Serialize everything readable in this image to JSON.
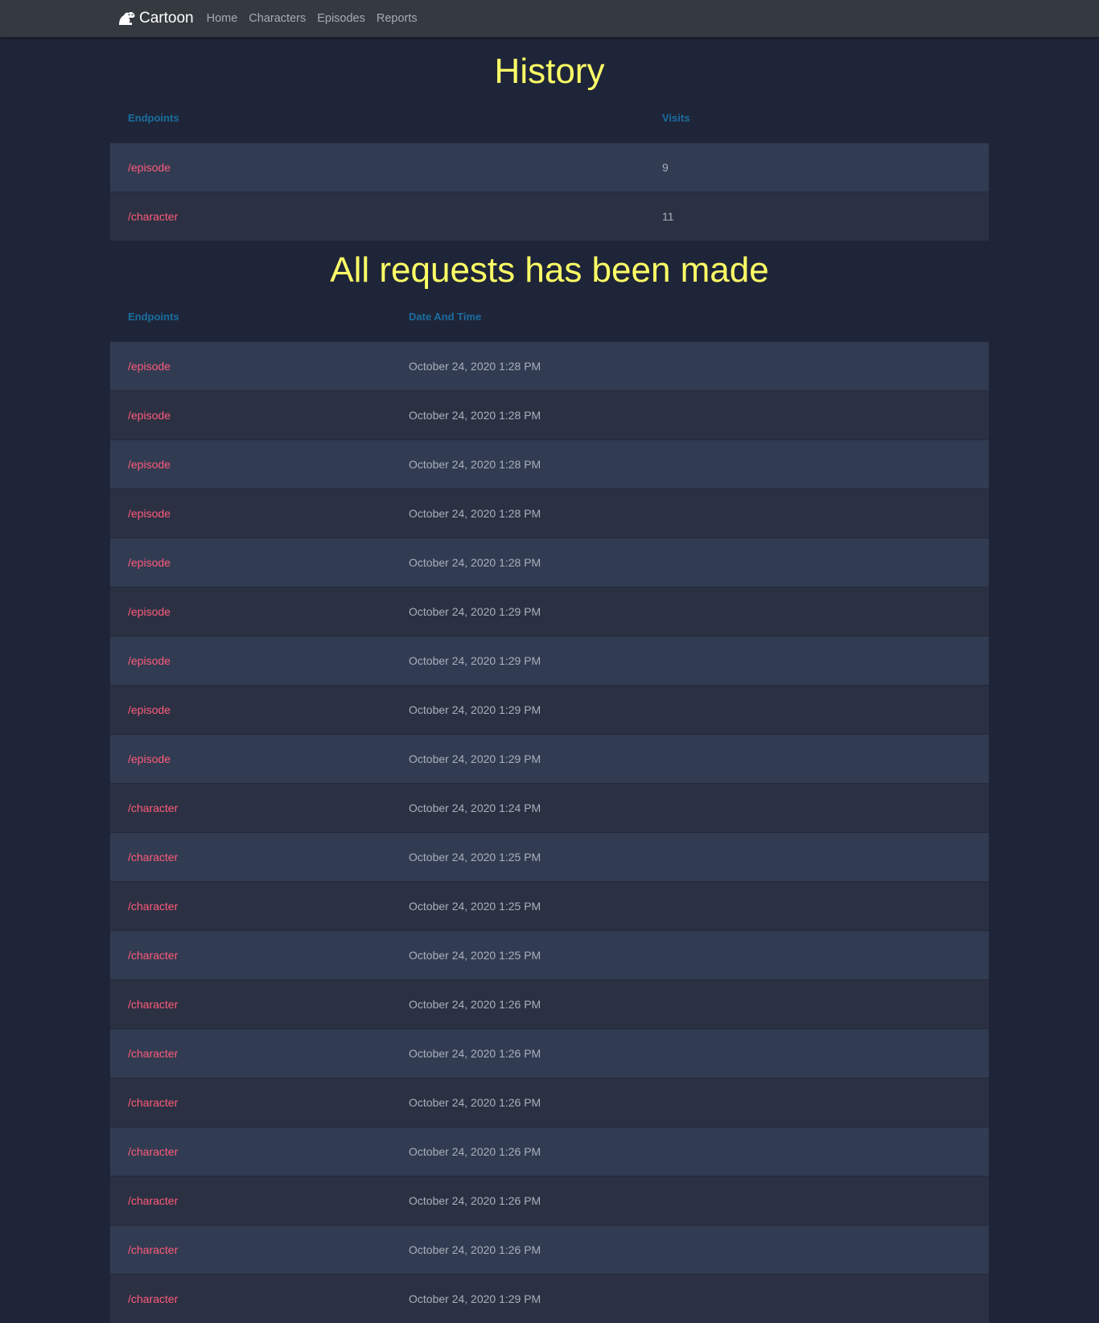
{
  "navbar": {
    "brand": "Cartoon",
    "links": [
      "Home",
      "Characters",
      "Episodes",
      "Reports"
    ]
  },
  "history": {
    "title": "History",
    "headers": [
      "Endpoints",
      "Visits"
    ],
    "rows": [
      [
        "/episode",
        "9"
      ],
      [
        "/character",
        "11"
      ]
    ]
  },
  "requests": {
    "title": "All requests has been made",
    "headers": [
      "Endpoints",
      "Date And Time"
    ],
    "rows": [
      [
        "/episode",
        "October 24, 2020 1:28 PM"
      ],
      [
        "/episode",
        "October 24, 2020 1:28 PM"
      ],
      [
        "/episode",
        "October 24, 2020 1:28 PM"
      ],
      [
        "/episode",
        "October 24, 2020 1:28 PM"
      ],
      [
        "/episode",
        "October 24, 2020 1:28 PM"
      ],
      [
        "/episode",
        "October 24, 2020 1:29 PM"
      ],
      [
        "/episode",
        "October 24, 2020 1:29 PM"
      ],
      [
        "/episode",
        "October 24, 2020 1:29 PM"
      ],
      [
        "/episode",
        "October 24, 2020 1:29 PM"
      ],
      [
        "/character",
        "October 24, 2020 1:24 PM"
      ],
      [
        "/character",
        "October 24, 2020 1:25 PM"
      ],
      [
        "/character",
        "October 24, 2020 1:25 PM"
      ],
      [
        "/character",
        "October 24, 2020 1:25 PM"
      ],
      [
        "/character",
        "October 24, 2020 1:26 PM"
      ],
      [
        "/character",
        "October 24, 2020 1:26 PM"
      ],
      [
        "/character",
        "October 24, 2020 1:26 PM"
      ],
      [
        "/character",
        "October 24, 2020 1:26 PM"
      ],
      [
        "/character",
        "October 24, 2020 1:26 PM"
      ],
      [
        "/character",
        "October 24, 2020 1:26 PM"
      ],
      [
        "/character",
        "October 24, 2020 1:29 PM"
      ]
    ]
  }
}
